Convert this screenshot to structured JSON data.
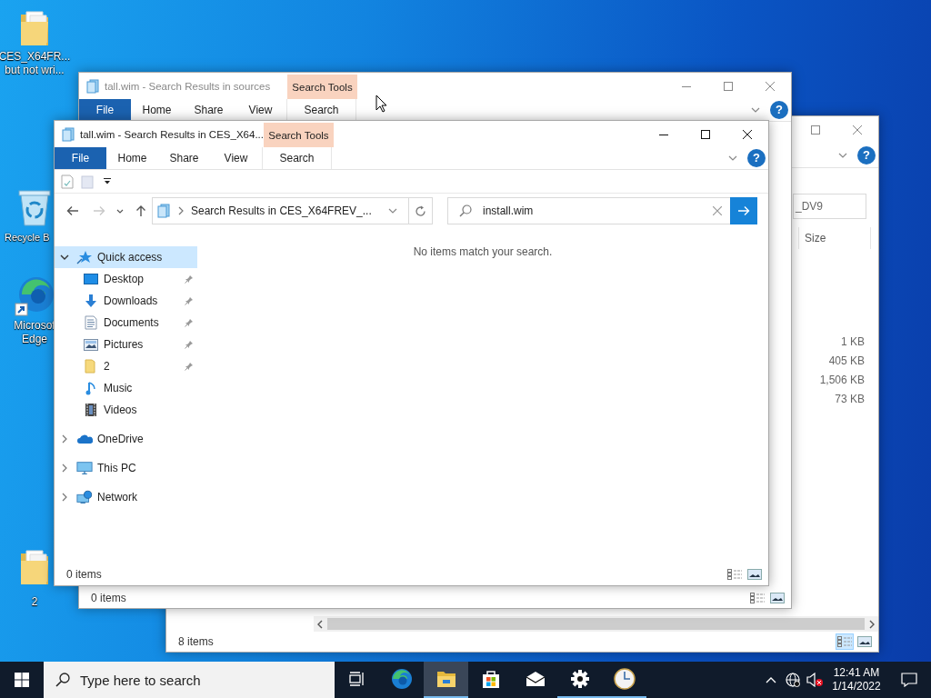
{
  "desktop": {
    "icons": [
      {
        "kind": "folder",
        "lines": [
          "CES_X64FR...",
          "but not wri..."
        ]
      },
      {
        "kind": "recycle-bin",
        "lines": [
          "Recycle B"
        ]
      },
      {
        "kind": "edge",
        "lines": [
          "Microsof",
          "Edge"
        ]
      },
      {
        "kind": "folder",
        "lines": [
          "2"
        ]
      }
    ]
  },
  "back_window": {
    "search": {
      "value": "_DV9"
    },
    "help": "?",
    "size_column": {
      "header": "Size",
      "values": [
        "1 KB",
        "405 KB",
        "1,506 KB",
        "73 KB"
      ]
    },
    "status": "8 items",
    "view_buttons": [
      {
        "kind": "details",
        "selected": true
      },
      {
        "kind": "large-icons",
        "selected": false
      }
    ]
  },
  "middle_window": {
    "title": "tall.wim - Search Results in sources",
    "tabs": [
      {
        "label": "File",
        "kind": "file"
      },
      {
        "label": "Home",
        "kind": "plain"
      },
      {
        "label": "Share",
        "kind": "plain"
      },
      {
        "label": "View",
        "kind": "plain"
      }
    ],
    "context_group": {
      "label": "Search Tools",
      "tabs": [
        "Search"
      ]
    },
    "help": "?",
    "status": "0 items",
    "view_buttons": [
      {
        "kind": "details",
        "selected": false
      },
      {
        "kind": "large-icons",
        "selected": false
      }
    ]
  },
  "front_window": {
    "title": "tall.wim - Search Results in CES_X64...",
    "tabs": [
      {
        "label": "File",
        "kind": "file"
      },
      {
        "label": "Home",
        "kind": "plain"
      },
      {
        "label": "Share",
        "kind": "plain"
      },
      {
        "label": "View",
        "kind": "plain"
      }
    ],
    "context_group": {
      "label": "Search Tools",
      "tabs": [
        "Search"
      ]
    },
    "help": "?",
    "nav_buttons": [
      {
        "kind": "back",
        "disabled": false
      },
      {
        "kind": "forward",
        "disabled": true
      },
      {
        "kind": "recent",
        "disabled": false
      },
      {
        "kind": "up",
        "disabled": false
      }
    ],
    "address": "Search Results in CES_X64FREV_...",
    "search": {
      "value": "install.wim"
    },
    "nav": [
      {
        "label": "Quick access",
        "kind": "quick-access",
        "expanded": true,
        "selected": true,
        "children": [
          {
            "label": "Desktop",
            "kind": "desktop",
            "pinned": true
          },
          {
            "label": "Downloads",
            "kind": "downloads",
            "pinned": true
          },
          {
            "label": "Documents",
            "kind": "documents",
            "pinned": true
          },
          {
            "label": "Pictures",
            "kind": "pictures",
            "pinned": true
          },
          {
            "label": "2",
            "kind": "folder",
            "pinned": true
          },
          {
            "label": "Music",
            "kind": "music",
            "pinned": false
          },
          {
            "label": "Videos",
            "kind": "videos",
            "pinned": false
          }
        ]
      },
      {
        "label": "OneDrive",
        "kind": "onedrive",
        "expanded": false,
        "selected": false
      },
      {
        "label": "This PC",
        "kind": "pc",
        "expanded": false,
        "selected": false
      },
      {
        "label": "Network",
        "kind": "network",
        "expanded": false,
        "selected": false
      }
    ],
    "message": "No items match your search.",
    "status": "0 items",
    "view_buttons": [
      {
        "kind": "details",
        "selected": false
      },
      {
        "kind": "large-icons",
        "selected": false
      }
    ]
  },
  "taskbar": {
    "search": {
      "placeholder": "Type here to search"
    },
    "apps": [
      {
        "kind": "task-view",
        "running": false,
        "selected": false
      },
      {
        "kind": "edge",
        "running": false,
        "selected": false
      },
      {
        "kind": "explorer",
        "running": true,
        "selected": true
      },
      {
        "kind": "store",
        "running": false,
        "selected": false
      },
      {
        "kind": "mail",
        "running": false,
        "selected": false
      },
      {
        "kind": "settings",
        "running": true,
        "selected": false
      },
      {
        "kind": "clock",
        "running": true,
        "selected": false
      }
    ],
    "tray": {
      "volume_muted": true,
      "time": "12:41 AM",
      "date": "1/14/2022"
    }
  }
}
